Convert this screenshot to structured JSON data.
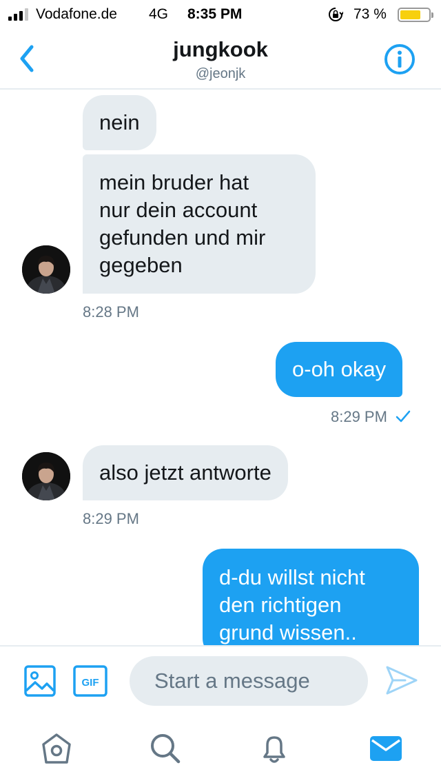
{
  "status_bar": {
    "carrier": "Vodafone.de",
    "network": "4G",
    "time": "8:35 PM",
    "battery": "73 %"
  },
  "header": {
    "name": "jungkook",
    "handle": "@jeonjk"
  },
  "messages": [
    {
      "from": "them",
      "text": "nein"
    },
    {
      "from": "them",
      "lines": [
        "mein bruder hat",
        "nur dein account",
        "gefunden und mir",
        "gegeben"
      ],
      "time": "8:28 PM"
    },
    {
      "from": "me",
      "text": "o-oh okay",
      "time": "8:29 PM",
      "seen": true
    },
    {
      "from": "them",
      "text": "also jetzt antworte",
      "time": "8:29 PM"
    },
    {
      "from": "me",
      "lines": [
        "d-du willst nicht",
        "den richtigen",
        "grund wissen.."
      ]
    }
  ],
  "compose": {
    "placeholder": "Start a message",
    "gif_label": "GIF"
  },
  "colors": {
    "accent": "#1da1f2",
    "received_bubble": "#e6ecf0",
    "meta_text": "#657786"
  }
}
